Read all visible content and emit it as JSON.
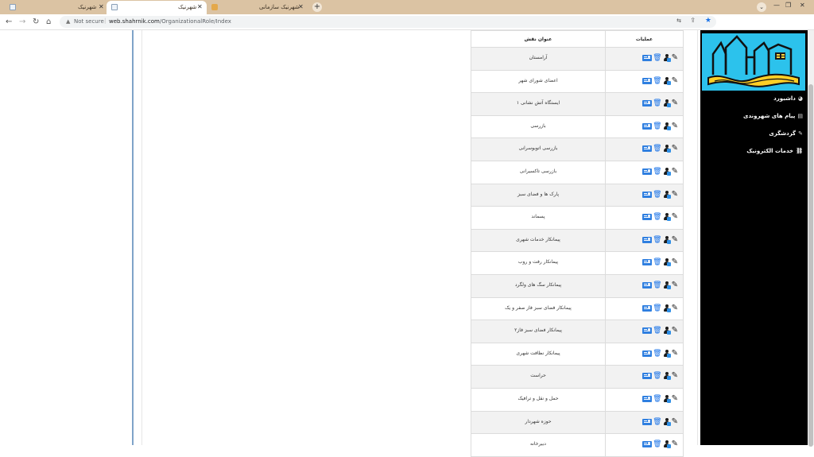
{
  "browser": {
    "tabs": [
      {
        "title": "شهرنیک",
        "active": false
      },
      {
        "title": "شهرنیک",
        "active": true
      },
      {
        "title": "شهرنیک سازمانی",
        "active": false
      }
    ],
    "new_tab": "+",
    "address": {
      "security": "Not secure",
      "host": "web.shahrnik.com",
      "path": "/OrganizationalRole/Index"
    }
  },
  "table": {
    "headers": {
      "operations": "عملیات",
      "title": "عنوان نقش"
    },
    "rows": [
      "آرامستان",
      "اعضای شورای شهر",
      "ایستگاه آتش نشانی ۱",
      "بازرسی",
      "بازرسی اتوبوسرانی",
      "بازرسی تاکسیرانی",
      "پارک ها و فضای سبز",
      "پسماند",
      "پیمانکار خدمات شهری",
      "پیمانکار رفت و روب",
      "پیمانکار سگ های ولگرد",
      "پیمانکار فضای سبز فاز صفر و یک",
      "پیمانکار فضای سبز فاز۲",
      "پیمانکار نظافت شهری",
      "حراست",
      "حمل و نقل و ترافیک",
      "حوزه شهردار",
      "دبیرخانه"
    ]
  },
  "sidebar": {
    "items": [
      {
        "label": "داشبورد",
        "icon": "dashboard-icon"
      },
      {
        "label": "پیام های شهروندی",
        "icon": "keyboard-icon"
      },
      {
        "label": "گردشگری",
        "icon": "edit-icon"
      },
      {
        "label": "خدمات الکترونیک",
        "icon": "link-icon"
      }
    ]
  },
  "colors": {
    "tabbar": "#dbc3a3",
    "accent": "#1a73e8",
    "logo_bg": "#2cc2ec",
    "sidebar_bg": "#000000"
  }
}
